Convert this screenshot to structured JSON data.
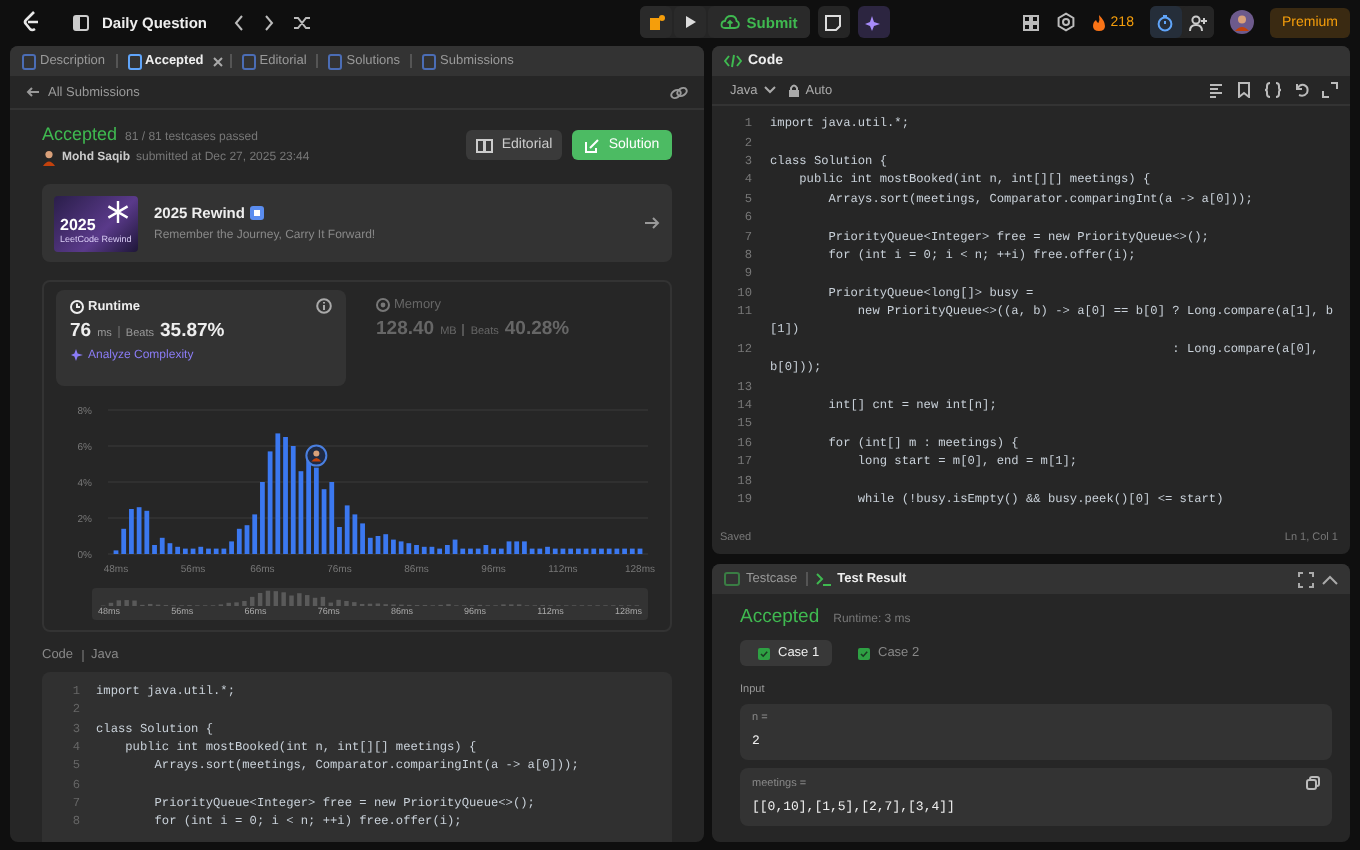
{
  "top_bar": {
    "title": "Daily Question",
    "submit": "Submit",
    "streak": "218",
    "premium": "Premium"
  },
  "left_tabs": [
    {
      "label": "Description",
      "selected": false
    },
    {
      "label": "Accepted",
      "selected": true
    },
    {
      "label": "Editorial",
      "selected": false
    },
    {
      "label": "Solutions",
      "selected": false
    },
    {
      "label": "Submissions",
      "selected": false
    }
  ],
  "back_link": "All Submissions",
  "submission": {
    "status": "Accepted",
    "passed": "81 / 81 testcases passed",
    "author": "Mohd Saqib",
    "submitted": "submitted at Dec 27, 2025 23:44",
    "buttons": [
      {
        "label": "Editorial",
        "kind": "secondary"
      },
      {
        "label": "Solution",
        "kind": "primary"
      }
    ]
  },
  "banner": {
    "image_year": "2025",
    "image_caption": "LeetCode Rewind",
    "title": "2025 Rewind",
    "subtitle": "Remember the Journey, Carry It Forward!"
  },
  "stats": [
    {
      "kind": "runtime",
      "title": "Runtime",
      "value": "76",
      "unit": "ms",
      "beats_label": "Beats",
      "beats": "35.87%",
      "selected": true,
      "link": "Analyze Complexity"
    },
    {
      "kind": "memory",
      "title": "Memory",
      "value": "128.40",
      "unit": "MB",
      "beats_label": "Beats",
      "beats": "40.28%",
      "selected": false
    }
  ],
  "chart_data": {
    "type": "bar",
    "ylim": [
      0,
      8
    ],
    "yticks": [
      {
        "value": 0,
        "label": "0%"
      },
      {
        "value": 2,
        "label": "2%"
      },
      {
        "value": 4,
        "label": "4%"
      },
      {
        "value": 6,
        "label": "6%"
      },
      {
        "value": 8,
        "label": "8%"
      }
    ],
    "categories": [
      "48ms",
      null,
      null,
      null,
      null,
      null,
      null,
      null,
      null,
      null,
      "56ms",
      null,
      null,
      null,
      null,
      null,
      null,
      null,
      null,
      "66ms",
      null,
      null,
      null,
      null,
      null,
      null,
      null,
      null,
      null,
      "76ms",
      null,
      null,
      null,
      null,
      null,
      null,
      null,
      null,
      null,
      "86ms",
      null,
      null,
      null,
      null,
      null,
      null,
      null,
      null,
      null,
      "96ms",
      null,
      null,
      null,
      null,
      null,
      null,
      null,
      null,
      "112ms",
      null,
      null,
      null,
      null,
      null,
      null,
      null,
      null,
      null,
      "128ms"
    ],
    "series": [
      {
        "color": "#3b78f0",
        "values": [
          0.2,
          1.4,
          2.5,
          2.6,
          2.4,
          0.5,
          0.9,
          0.6,
          0.4,
          0.3,
          0.3,
          0.4,
          0.3,
          0.3,
          0.3,
          0.7,
          1.4,
          1.6,
          2.2,
          4.0,
          5.7,
          6.7,
          6.5,
          6.0,
          4.6,
          5.6,
          4.8,
          3.6,
          4.0,
          1.5,
          2.7,
          2.2,
          1.7,
          0.9,
          1.0,
          1.1,
          0.8,
          0.7,
          0.6,
          0.5,
          0.4,
          0.4,
          0.3,
          0.5,
          0.8,
          0.3,
          0.3,
          0.3,
          0.5,
          0.3,
          0.3,
          0.7,
          0.7,
          0.7,
          0.3,
          0.3,
          0.4,
          0.3,
          0.3,
          0.3,
          0.3,
          0.3,
          0.3,
          0.3,
          0.3,
          0.3,
          0.3,
          0.3,
          0.3
        ]
      }
    ],
    "grid": true
  },
  "navigator_labels": [
    "48ms",
    "56ms",
    "66ms",
    "76ms",
    "86ms",
    "96ms",
    "112ms",
    "128ms"
  ],
  "code_section": {
    "label": "Code",
    "language": "Java",
    "lines": [
      {
        "number": "1",
        "text": "import java.util.*;"
      },
      {
        "number": "2"
      },
      {
        "number": "3",
        "text": "class Solution {"
      },
      {
        "number": "4",
        "text": "    public int mostBooked(int n, int[][] meetings) {"
      },
      {
        "number": "5",
        "text": "        Arrays.sort(meetings, Comparator.comparingInt(a -> a[0]));"
      },
      {
        "number": "6"
      },
      {
        "number": "7",
        "text": "        PriorityQueue<Integer> free = new PriorityQueue<>();"
      },
      {
        "number": "8",
        "text": "        for (int i = 0; i < n; ++i) free.offer(i);"
      }
    ]
  },
  "editor": {
    "title": "Code",
    "language": "Java",
    "mode": "Auto",
    "status": "Saved",
    "cursor": "Ln 1, Col 1",
    "lines": [
      {
        "number": "1",
        "text": "import java.util.*;"
      },
      {
        "number": "2"
      },
      {
        "number": "3",
        "text": "class Solution {"
      },
      {
        "number": "4",
        "text": "    public int mostBooked(int n, int[][] meetings) {"
      },
      {
        "number": "5",
        "text": "        Arrays.sort(meetings, Comparator.comparingInt(a -> a[0]));"
      },
      {
        "number": "6"
      },
      {
        "number": "7",
        "text": "        PriorityQueue<Integer> free = new PriorityQueue<>();"
      },
      {
        "number": "8",
        "text": "        for (int i = 0; i < n; ++i) free.offer(i);"
      },
      {
        "number": "9"
      },
      {
        "number": "10",
        "text": "        PriorityQueue<long[]> busy ="
      },
      {
        "number": "11",
        "text": "            new PriorityQueue<>((a, b) -> a[0] == b[0] ? Long.compare(a[1], b",
        "continuation": "[1])"
      },
      {
        "number": "12",
        "text": "                                                       : Long.compare(a[0],",
        "continuation": "b[0]));"
      },
      {
        "number": "13"
      },
      {
        "number": "14",
        "text": "        int[] cnt = new int[n];"
      },
      {
        "number": "15"
      },
      {
        "number": "16",
        "text": "        for (int[] m : meetings) {"
      },
      {
        "number": "17",
        "text": "            long start = m[0], end = m[1];"
      },
      {
        "number": "18"
      },
      {
        "number": "19",
        "text": "            while (!busy.isEmpty() && busy.peek()[0] <= start)"
      }
    ]
  },
  "bottom_tabs": [
    {
      "label": "Testcase",
      "selected": false
    },
    {
      "label": "Test Result",
      "selected": true
    }
  ],
  "result": {
    "status": "Accepted",
    "runtime": "Runtime: 3 ms",
    "cases": [
      {
        "label": "Case 1",
        "selected": true,
        "passed": true
      },
      {
        "label": "Case 2",
        "selected": false,
        "passed": true
      }
    ],
    "input_label": "Input",
    "inputs": [
      {
        "name": "n =",
        "value": "2"
      },
      {
        "name": "meetings =",
        "value": "[[0,10],[1,5],[2,7],[3,4]]"
      }
    ]
  }
}
